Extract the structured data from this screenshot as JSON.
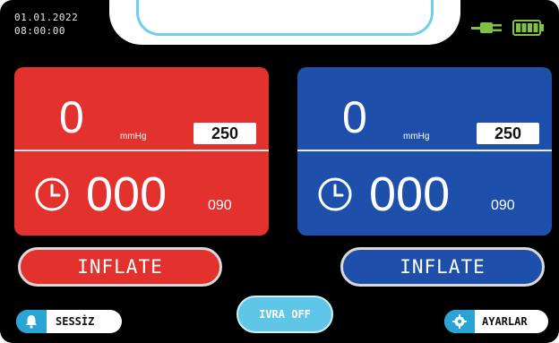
{
  "status": {
    "date": "01.01.2022",
    "time": "08:00:00"
  },
  "icons": {
    "plug": "power-plug-icon",
    "battery": "battery-full-icon",
    "clock": "clock-icon",
    "bell": "bell-icon",
    "gear": "gear-icon"
  },
  "colors": {
    "red_channel": "#e3312e",
    "blue_channel": "#1e4faa",
    "accent": "#2aa3d6",
    "battery": "#7ec245"
  },
  "left_channel": {
    "pressure": "0",
    "unit": "mmHg",
    "pressure_limit": "250",
    "time": "000",
    "time_limit": "090",
    "button_label": "INFLATE"
  },
  "right_channel": {
    "pressure": "0",
    "unit": "mmHg",
    "pressure_limit": "250",
    "time": "000",
    "time_limit": "090",
    "button_label": "INFLATE"
  },
  "footer": {
    "mute_label": "SESSİZ",
    "ivra_label": "IVRA OFF",
    "settings_label": "AYARLAR"
  }
}
